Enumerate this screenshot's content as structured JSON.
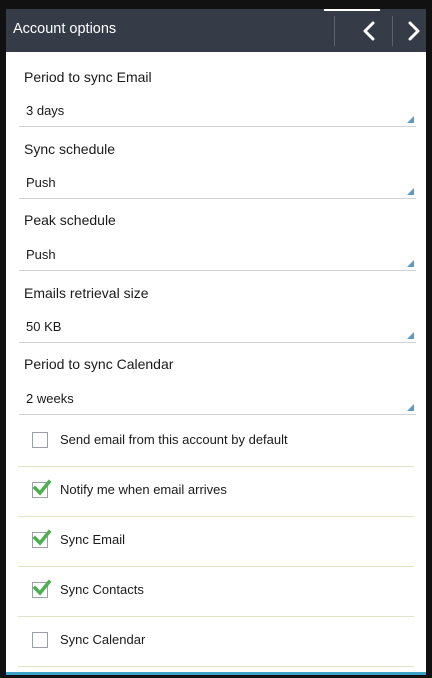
{
  "header": {
    "title": "Account options",
    "prev_icon": "chevron-left-icon",
    "next_icon": "chevron-right-icon"
  },
  "settings": [
    {
      "label": "Period to sync Email",
      "value": "3 days"
    },
    {
      "label": "Sync schedule",
      "value": "Push"
    },
    {
      "label": "Peak schedule",
      "value": "Push"
    },
    {
      "label": "Emails retrieval size",
      "value": "50 KB"
    },
    {
      "label": "Period to sync Calendar",
      "value": "2 weeks"
    }
  ],
  "checkboxes": [
    {
      "label": "Send email from this account by default",
      "checked": false
    },
    {
      "label": "Notify me when email arrives",
      "checked": true
    },
    {
      "label": "Sync Email",
      "checked": true
    },
    {
      "label": "Sync Contacts",
      "checked": true
    },
    {
      "label": "Sync Calendar",
      "checked": false
    }
  ],
  "colors": {
    "actionbar": "#353b47",
    "check_green": "#4caf50",
    "caret_blue": "#5b9bc9",
    "accent_stripe": "#3ea2c8"
  }
}
